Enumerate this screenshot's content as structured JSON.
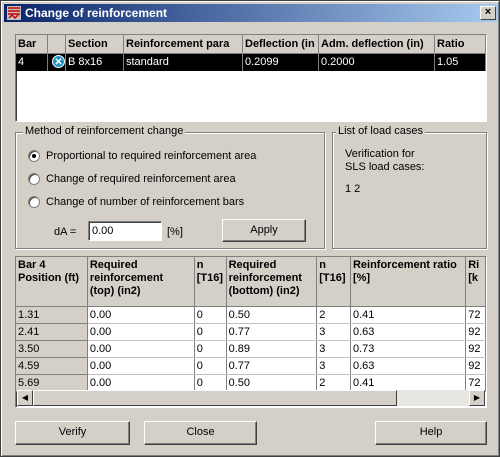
{
  "window": {
    "title": "Change of reinforcement",
    "close_label": "×"
  },
  "top_grid": {
    "headers": [
      "Bar",
      "",
      "Section",
      "Reinforcement para",
      "Deflection (in",
      "Adm. deflection (in)",
      "Ratio"
    ],
    "row": {
      "bar": "4",
      "status_icon": "x-circle-icon",
      "section": "B 8x16",
      "param": "standard",
      "deflection": "0.2099",
      "adm_deflection": "0.2000",
      "ratio": "1.05"
    }
  },
  "method": {
    "title": "Method of reinforcement change",
    "options": [
      "Proportional to required reinforcement area",
      "Change of required reinforcement area",
      "Change of number of reinforcement bars"
    ],
    "selected_index": 0,
    "da_label": "dA =",
    "da_value": "0.00",
    "da_unit": "[%]",
    "apply_label": "Apply"
  },
  "load_cases": {
    "title": "List of load cases",
    "text1": "Verification for",
    "text2": "SLS load cases:",
    "cases": "1 2"
  },
  "bottom_grid": {
    "headers": [
      [
        "Bar 4",
        "Position (ft)",
        ""
      ],
      [
        "Required",
        "reinforcement",
        "(top) (in2)"
      ],
      [
        "n",
        "[T16]",
        ""
      ],
      [
        "Required",
        "reinforcement",
        "(bottom) (in2)"
      ],
      [
        "n",
        "[T16]",
        ""
      ],
      [
        "Reinforcement ratio",
        "[%]",
        ""
      ],
      [
        "Ri",
        "[k",
        ""
      ]
    ],
    "rows": [
      [
        "1.31",
        "0.00",
        "0",
        "0.50",
        "2",
        "0.41",
        "72"
      ],
      [
        "2.41",
        "0.00",
        "0",
        "0.77",
        "3",
        "0.63",
        "92"
      ],
      [
        "3.50",
        "0.00",
        "0",
        "0.89",
        "3",
        "0.73",
        "92"
      ],
      [
        "4.59",
        "0.00",
        "0",
        "0.77",
        "3",
        "0.63",
        "92"
      ],
      [
        "5.69",
        "0.00",
        "0",
        "0.50",
        "2",
        "0.41",
        "72"
      ]
    ]
  },
  "buttons": {
    "verify": "Verify",
    "close": "Close",
    "help": "Help"
  }
}
